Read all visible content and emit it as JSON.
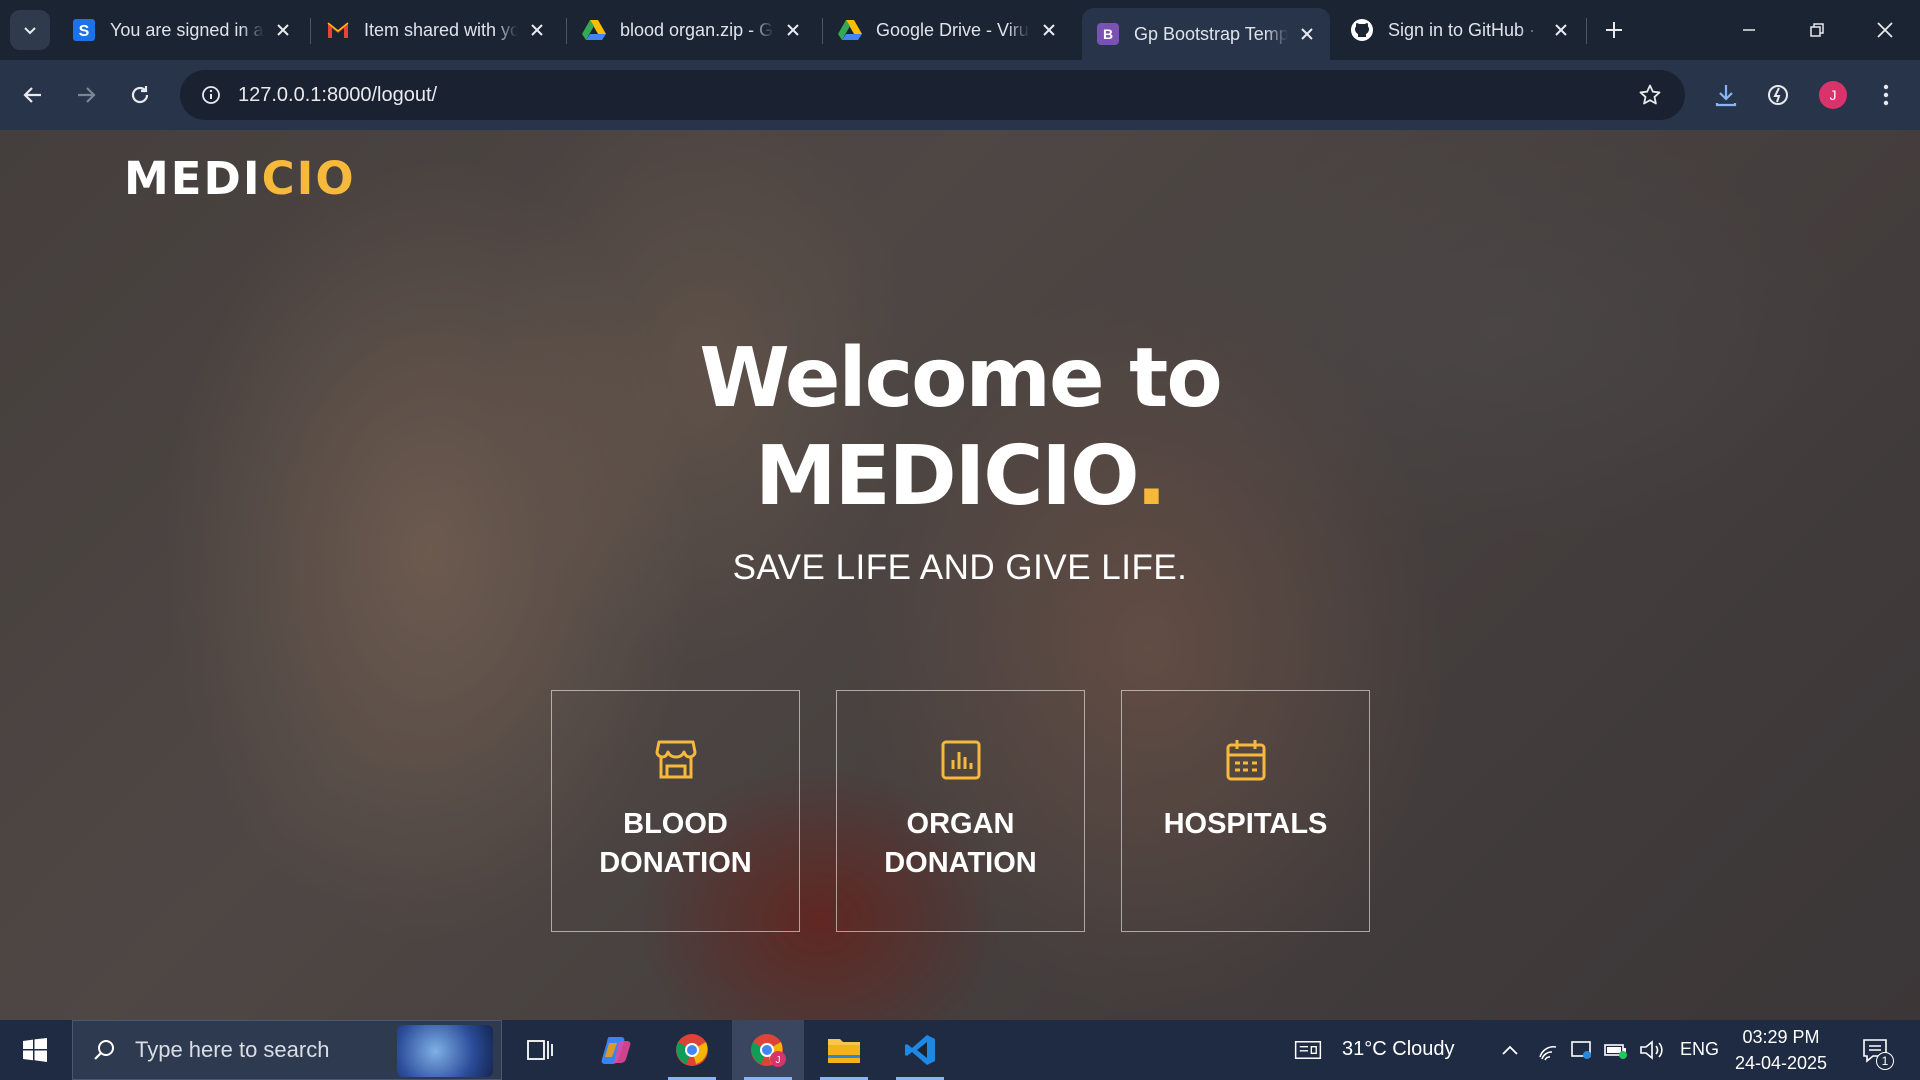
{
  "browser": {
    "tabs": [
      {
        "title": "You are signed in as",
        "favicon": "s-icon",
        "active": false
      },
      {
        "title": "Item shared with you",
        "favicon": "gmail-icon",
        "active": false
      },
      {
        "title": "blood organ.zip - Google Drive",
        "favicon": "google-drive-icon",
        "active": false
      },
      {
        "title": "Google Drive - Virus scan warning",
        "favicon": "google-drive-icon",
        "active": false
      },
      {
        "title": "Gp Bootstrap Template",
        "favicon": "bootstrap-icon",
        "active": true
      },
      {
        "title": "Sign in to GitHub · GitHub",
        "favicon": "github-icon",
        "active": false
      }
    ],
    "url": "127.0.0.1:8000/logout/",
    "profile_initial": "J"
  },
  "page": {
    "brand": {
      "main": "MEDI",
      "accent": "CIO"
    },
    "hero": {
      "line1": "Welcome to",
      "line2": "MEDICIO",
      "dot": ".",
      "tagline": "SAVE LIFE AND GIVE LIFE."
    },
    "cards": [
      {
        "label": "BLOOD DONATION",
        "icon": "shop-window-icon"
      },
      {
        "label": "ORGAN DONATION",
        "icon": "bar-chart-icon"
      },
      {
        "label": "HOSPITALS",
        "icon": "calendar-icon"
      }
    ],
    "accent_color": "#f6b93b"
  },
  "taskbar": {
    "search_placeholder": "Type here to search",
    "weather": "31°C  Cloudy",
    "language": "ENG",
    "time": "03:29 PM",
    "date": "24-04-2025",
    "notification_count": "1"
  }
}
